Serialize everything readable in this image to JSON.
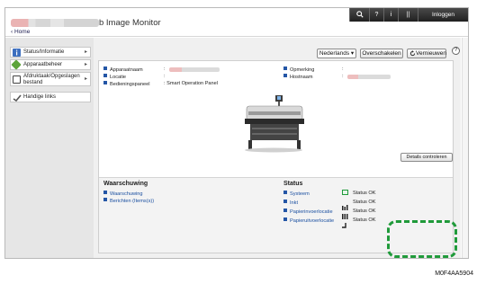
{
  "header": {
    "app_title": "b Image Monitor",
    "home_link": "‹ Home",
    "topbar": {
      "search_icon": "search-icon",
      "help_glyph": "?",
      "info_glyph": "i",
      "account_glyph": "||",
      "login_label": "Inloggen"
    }
  },
  "toolbar": {
    "language": "Nederlands ▾",
    "switch_label": "Overschakelen",
    "refresh_label": "Vernieuwen",
    "help_glyph": "?"
  },
  "sidebar": {
    "items": [
      {
        "label": "Status/Informatie",
        "icon": "info-icon",
        "color": "#3d6fbf"
      },
      {
        "label": "Apparaatbeheer",
        "icon": "device-icon",
        "color": "#5da43a"
      },
      {
        "label": "Afdruktaak/Opgeslagen bestand",
        "icon": "document-icon",
        "color": "#4b4b4b"
      },
      {
        "label": "Handige links",
        "icon": "link-icon",
        "color": "#7a7a7a"
      }
    ]
  },
  "device_info": {
    "name_label": "Apparaatnaam",
    "location_label": "Locatie",
    "panel_label": "Bedieningspaneel",
    "panel_value": ": Smart Operation Panel",
    "comment_label": "Opmerking",
    "host_label": "Hostnaam",
    "colon": ":"
  },
  "warning": {
    "title": "Waarschuwing",
    "items": [
      "Waarschuwing",
      "Berichten (Items(s))"
    ]
  },
  "status": {
    "title": "Status",
    "rows": [
      {
        "label": "Systeem",
        "value": "Status OK",
        "icon": "system-ok-icon"
      },
      {
        "label": "Inkt",
        "value": "Status OK",
        "icon": "ink-icon"
      },
      {
        "label": "Papierinvoerlocatie",
        "value": "Status OK",
        "icon": "paper-input-icon"
      },
      {
        "label": "Papieruitvoerlocatie",
        "value": "Status OK",
        "icon": "paper-output-icon"
      }
    ],
    "details_label": "Details controleren"
  },
  "figure_code": "M0F4AA5904",
  "colors": {
    "accent_green": "#1f9a3a",
    "link_blue": "#1a4fa0",
    "topbar": "#2a2a2a"
  }
}
